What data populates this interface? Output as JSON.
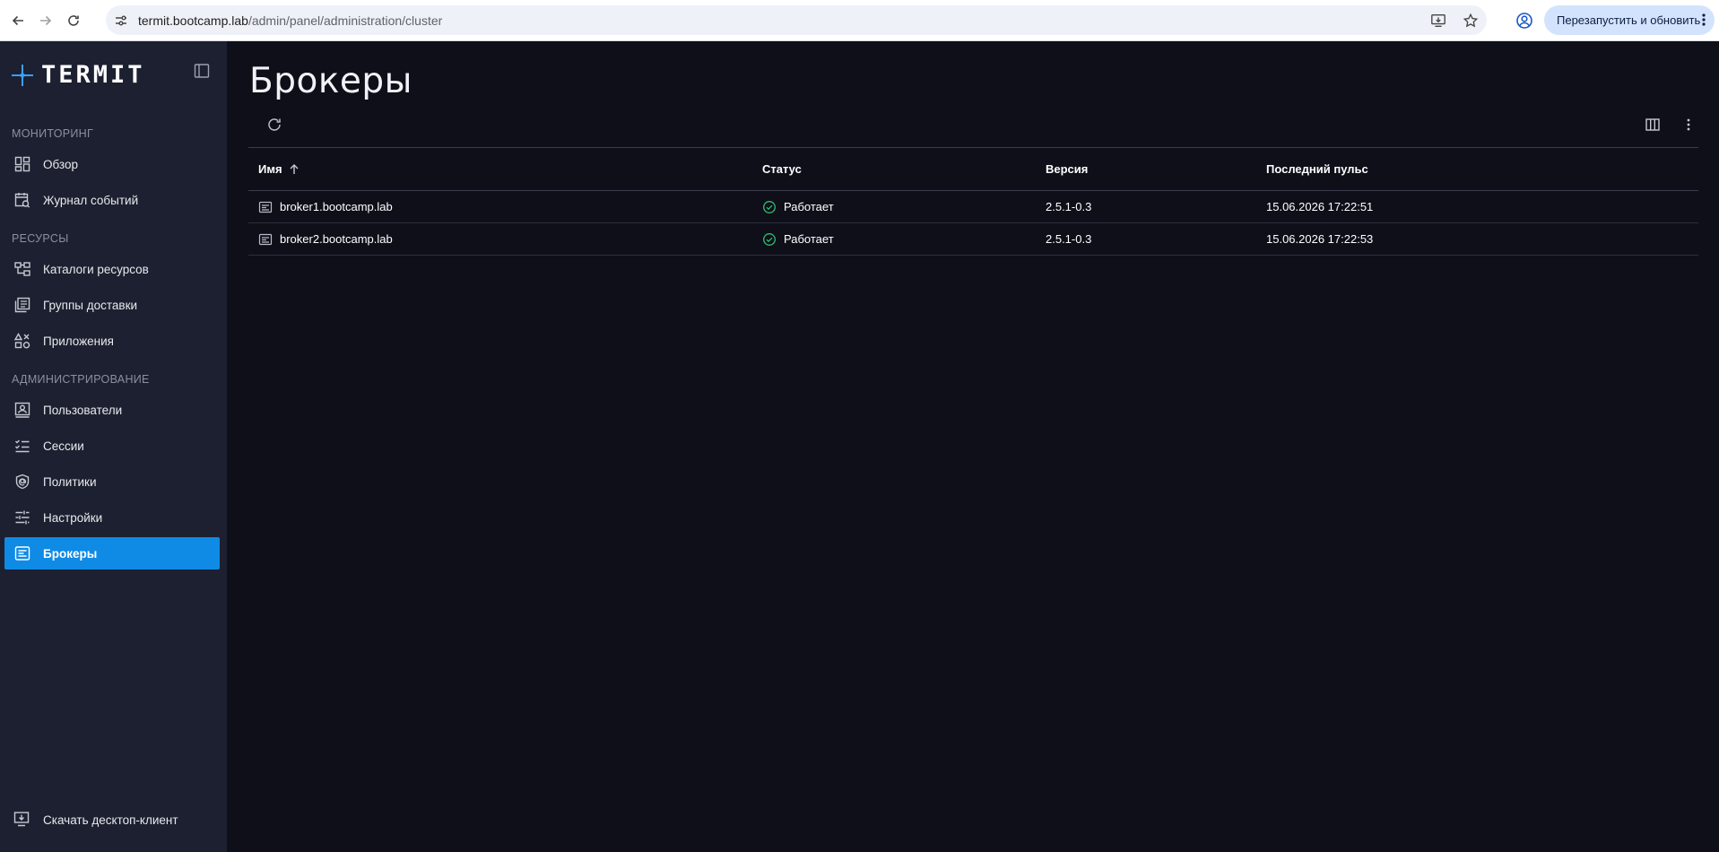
{
  "browser": {
    "url_host": "termit.bootcamp.lab",
    "url_path": "/admin/panel/administration/cluster",
    "restart_label": "Перезапустить и обновить"
  },
  "sidebar": {
    "logo_text": "TERMIT",
    "sections": {
      "monitoring": "МОНИТОРИНГ",
      "resources": "РЕСУРСЫ",
      "administration": "АДМИНИСТРИРОВАНИЕ"
    },
    "items": [
      {
        "label": "Обзор",
        "icon": "dashboard-icon"
      },
      {
        "label": "Журнал событий",
        "icon": "event-log-icon"
      },
      {
        "label": "Каталоги ресурсов",
        "icon": "catalog-icon"
      },
      {
        "label": "Группы доставки",
        "icon": "delivery-groups-icon"
      },
      {
        "label": "Приложения",
        "icon": "apps-icon"
      },
      {
        "label": "Пользователи",
        "icon": "users-icon"
      },
      {
        "label": "Сессии",
        "icon": "sessions-icon"
      },
      {
        "label": "Политики",
        "icon": "policies-icon"
      },
      {
        "label": "Настройки",
        "icon": "settings-icon"
      },
      {
        "label": "Брокеры",
        "icon": "brokers-icon",
        "active": true
      }
    ],
    "download_label": "Скачать десктоп-клиент"
  },
  "main": {
    "title": "Брокеры",
    "table": {
      "columns": [
        "Имя",
        "Статус",
        "Версия",
        "Последний пульс"
      ],
      "rows": [
        {
          "name": "broker1.bootcamp.lab",
          "status": "Работает",
          "version": "2.5.1-0.3",
          "heartbeat": "15.06.2026 17:22:51"
        },
        {
          "name": "broker2.bootcamp.lab",
          "status": "Работает",
          "version": "2.5.1-0.3",
          "heartbeat": "15.06.2026 17:22:53"
        }
      ]
    }
  },
  "colors": {
    "accent": "#0f8be6",
    "sidebar_bg": "#1d2030",
    "main_bg": "#0f0f1a",
    "status_ok": "#2fbf71"
  }
}
